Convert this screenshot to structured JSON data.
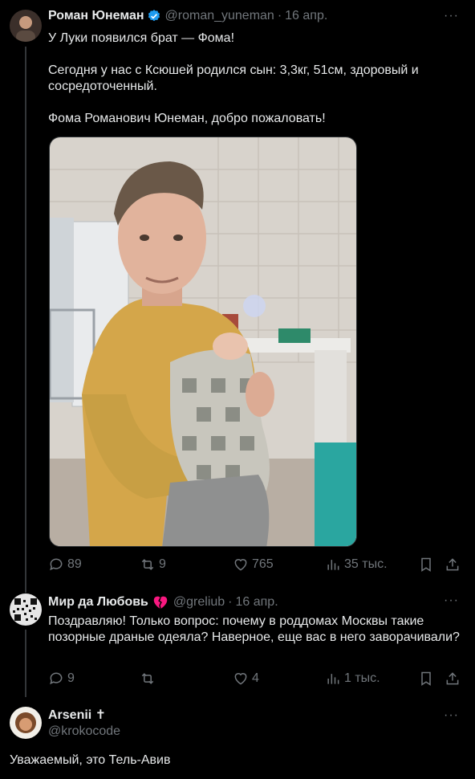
{
  "tweet1": {
    "author_name": "Роман Юнеман",
    "handle": "@roman_yuneman",
    "separator": "·",
    "date": "16 апр.",
    "text": "У Луки появился брат — Фома!\n\nСегодня у нас с Ксюшей родился сын: 3,3кг, 51см, здоровый и сосредоточенный.\n\nФома Романович Юнеман, добро пожаловать!",
    "more": "···",
    "stats": {
      "replies": "89",
      "retweets": "9",
      "likes": "765",
      "views": "35 тыс."
    }
  },
  "tweet2": {
    "author_name": "Мир да Любовь",
    "handle": "@greliub",
    "separator": "·",
    "date": "16 апр.",
    "text": "Поздравляю! Только вопрос: почему в роддомах Москвы такие позорные драные одеяла? Наверное, еще вас в него заворачивали?",
    "more": "···",
    "stats": {
      "replies": "9",
      "retweets": "",
      "likes": "4",
      "views": "1 тыс."
    }
  },
  "tweet3": {
    "author_name": "Arsenii ✝",
    "handle": "@krokocode",
    "text": "Уважаемый, это Тель-Авив",
    "more": "···"
  },
  "colors": {
    "background": "#000000",
    "text": "#e7e9ea",
    "muted": "#71767b",
    "verified": "#1d9bf0",
    "broken_heart": "#f91880"
  }
}
